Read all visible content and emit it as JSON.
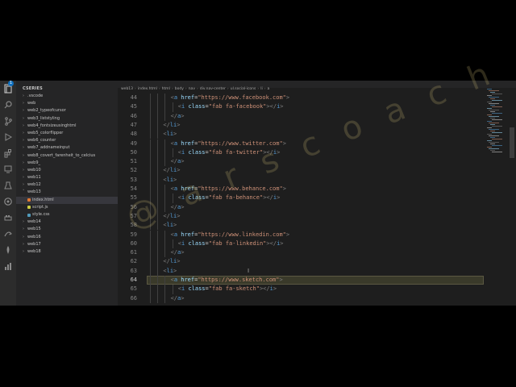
{
  "activity_bar": {
    "badge": "1",
    "icons": [
      "files-icon",
      "search-icon",
      "source-control-icon",
      "run-debug-icon",
      "extensions-icon",
      "remote-explorer-icon",
      "testing-icon",
      "github-icon",
      "docker-icon",
      "live-share-icon",
      "mongodb-icon",
      "chart-icon"
    ]
  },
  "sidebar": {
    "section_title": "CSERIES",
    "items": [
      {
        "label": ".vscode",
        "kind": "folder",
        "depth": 0
      },
      {
        "label": "web",
        "kind": "folder",
        "depth": 0
      },
      {
        "label": "web2_typeofcursor",
        "kind": "folder",
        "depth": 0
      },
      {
        "label": "web3_liststyling",
        "kind": "folder",
        "depth": 0
      },
      {
        "label": "web4_fontsizeusinghtml",
        "kind": "folder",
        "depth": 0
      },
      {
        "label": "web5_colorflipper",
        "kind": "folder",
        "depth": 0
      },
      {
        "label": "web6_counter",
        "kind": "folder",
        "depth": 0
      },
      {
        "label": "web7_addnameinput",
        "kind": "folder",
        "depth": 0
      },
      {
        "label": "web8_covert_farenheit_to_celcius",
        "kind": "folder",
        "depth": 0
      },
      {
        "label": "web9_",
        "kind": "folder",
        "depth": 0
      },
      {
        "label": "web10",
        "kind": "folder",
        "depth": 0
      },
      {
        "label": "web11",
        "kind": "folder",
        "depth": 0
      },
      {
        "label": "web12",
        "kind": "folder",
        "depth": 0
      },
      {
        "label": "web13",
        "kind": "folder-open",
        "depth": 0
      },
      {
        "label": "index.html",
        "kind": "html",
        "depth": 1,
        "active": true
      },
      {
        "label": "script.js",
        "kind": "js",
        "depth": 1
      },
      {
        "label": "style.css",
        "kind": "css",
        "depth": 1
      },
      {
        "label": "web14",
        "kind": "folder",
        "depth": 0
      },
      {
        "label": "web15",
        "kind": "folder",
        "depth": 0
      },
      {
        "label": "web16",
        "kind": "folder",
        "depth": 0
      },
      {
        "label": "web17",
        "kind": "folder",
        "depth": 0
      },
      {
        "label": "web18",
        "kind": "folder",
        "depth": 0
      }
    ]
  },
  "breadcrumbs": [
    "web13",
    "index.html",
    "html",
    "body",
    "nav",
    "div.nav-center",
    "ul.social-icons",
    "li",
    "a"
  ],
  "code_lines": [
    {
      "num": "44",
      "indent": 3,
      "tokens": [
        [
          "bracket",
          "<"
        ],
        [
          "tag",
          "a"
        ],
        [
          "text",
          " "
        ],
        [
          "attr",
          "href"
        ],
        [
          "text",
          "="
        ],
        [
          "val",
          "\"https://www.facebook.com\""
        ],
        [
          "bracket",
          ">"
        ]
      ]
    },
    {
      "num": "45",
      "indent": 4,
      "tokens": [
        [
          "bracket",
          "<"
        ],
        [
          "tag",
          "i"
        ],
        [
          "text",
          " "
        ],
        [
          "attr",
          "class"
        ],
        [
          "text",
          "="
        ],
        [
          "val",
          "\"fab fa-facebook\""
        ],
        [
          "bracket",
          "></"
        ],
        [
          "tag",
          "i"
        ],
        [
          "bracket",
          ">"
        ]
      ]
    },
    {
      "num": "46",
      "indent": 3,
      "tokens": [
        [
          "bracket",
          "</"
        ],
        [
          "tag",
          "a"
        ],
        [
          "bracket",
          ">"
        ]
      ]
    },
    {
      "num": "47",
      "indent": 2,
      "tokens": [
        [
          "bracket",
          "</"
        ],
        [
          "tag",
          "li"
        ],
        [
          "bracket",
          ">"
        ]
      ]
    },
    {
      "num": "48",
      "indent": 2,
      "tokens": [
        [
          "bracket",
          "<"
        ],
        [
          "tag",
          "li"
        ],
        [
          "bracket",
          ">"
        ]
      ]
    },
    {
      "num": "49",
      "indent": 3,
      "tokens": [
        [
          "bracket",
          "<"
        ],
        [
          "tag",
          "a"
        ],
        [
          "text",
          " "
        ],
        [
          "attr",
          "href"
        ],
        [
          "text",
          "="
        ],
        [
          "val",
          "\"https://www.twitter.com\""
        ],
        [
          "bracket",
          ">"
        ]
      ]
    },
    {
      "num": "50",
      "indent": 4,
      "tokens": [
        [
          "bracket",
          "<"
        ],
        [
          "tag",
          "i"
        ],
        [
          "text",
          " "
        ],
        [
          "attr",
          "class"
        ],
        [
          "text",
          "="
        ],
        [
          "val",
          "\"fab fa-twitter\""
        ],
        [
          "bracket",
          "></"
        ],
        [
          "tag",
          "i"
        ],
        [
          "bracket",
          ">"
        ]
      ]
    },
    {
      "num": "51",
      "indent": 3,
      "tokens": [
        [
          "bracket",
          "</"
        ],
        [
          "tag",
          "a"
        ],
        [
          "bracket",
          ">"
        ]
      ]
    },
    {
      "num": "52",
      "indent": 2,
      "tokens": [
        [
          "bracket",
          "</"
        ],
        [
          "tag",
          "li"
        ],
        [
          "bracket",
          ">"
        ]
      ]
    },
    {
      "num": "53",
      "indent": 2,
      "tokens": [
        [
          "bracket",
          "<"
        ],
        [
          "tag",
          "li"
        ],
        [
          "bracket",
          ">"
        ]
      ]
    },
    {
      "num": "54",
      "indent": 3,
      "tokens": [
        [
          "bracket",
          "<"
        ],
        [
          "tag",
          "a"
        ],
        [
          "text",
          " "
        ],
        [
          "attr",
          "href"
        ],
        [
          "text",
          "="
        ],
        [
          "val",
          "\"https://www.behance.com\""
        ],
        [
          "bracket",
          ">"
        ]
      ]
    },
    {
      "num": "55",
      "indent": 4,
      "tokens": [
        [
          "bracket",
          "<"
        ],
        [
          "tag",
          "i"
        ],
        [
          "text",
          " "
        ],
        [
          "attr",
          "class"
        ],
        [
          "text",
          "="
        ],
        [
          "val",
          "\"fab fa-behance\""
        ],
        [
          "bracket",
          "></"
        ],
        [
          "tag",
          "i"
        ],
        [
          "bracket",
          ">"
        ]
      ]
    },
    {
      "num": "56",
      "indent": 3,
      "tokens": [
        [
          "bracket",
          "</"
        ],
        [
          "tag",
          "a"
        ],
        [
          "bracket",
          ">"
        ]
      ]
    },
    {
      "num": "57",
      "indent": 2,
      "tokens": [
        [
          "bracket",
          "</"
        ],
        [
          "tag",
          "li"
        ],
        [
          "bracket",
          ">"
        ]
      ]
    },
    {
      "num": "58",
      "indent": 2,
      "tokens": [
        [
          "bracket",
          "<"
        ],
        [
          "tag",
          "li"
        ],
        [
          "bracket",
          ">"
        ]
      ]
    },
    {
      "num": "59",
      "indent": 3,
      "tokens": [
        [
          "bracket",
          "<"
        ],
        [
          "tag",
          "a"
        ],
        [
          "text",
          " "
        ],
        [
          "attr",
          "href"
        ],
        [
          "text",
          "="
        ],
        [
          "val",
          "\"https://www.linkedin.com\""
        ],
        [
          "bracket",
          ">"
        ]
      ]
    },
    {
      "num": "60",
      "indent": 4,
      "tokens": [
        [
          "bracket",
          "<"
        ],
        [
          "tag",
          "i"
        ],
        [
          "text",
          " "
        ],
        [
          "attr",
          "class"
        ],
        [
          "text",
          "="
        ],
        [
          "val",
          "\"fab fa-linkedin\""
        ],
        [
          "bracket",
          "></"
        ],
        [
          "tag",
          "i"
        ],
        [
          "bracket",
          ">"
        ]
      ]
    },
    {
      "num": "61",
      "indent": 3,
      "tokens": [
        [
          "bracket",
          "</"
        ],
        [
          "tag",
          "a"
        ],
        [
          "bracket",
          ">"
        ]
      ]
    },
    {
      "num": "62",
      "indent": 2,
      "tokens": [
        [
          "bracket",
          "</"
        ],
        [
          "tag",
          "li"
        ],
        [
          "bracket",
          ">"
        ]
      ]
    },
    {
      "num": "63",
      "indent": 2,
      "tokens": [
        [
          "bracket",
          "<"
        ],
        [
          "tag",
          "li"
        ],
        [
          "bracket",
          ">"
        ]
      ]
    },
    {
      "num": "64",
      "indent": 3,
      "current": true,
      "tokens": [
        [
          "bracket",
          "<"
        ],
        [
          "tag",
          "a"
        ],
        [
          "text",
          " "
        ],
        [
          "attr",
          "href"
        ],
        [
          "text",
          "="
        ],
        [
          "val",
          "\"https://www.sketch.com\""
        ],
        [
          "bracket",
          ">"
        ]
      ]
    },
    {
      "num": "65",
      "indent": 4,
      "tokens": [
        [
          "bracket",
          "<"
        ],
        [
          "tag",
          "i"
        ],
        [
          "text",
          " "
        ],
        [
          "attr",
          "class"
        ],
        [
          "text",
          "="
        ],
        [
          "val",
          "\"fab fa-sketch\""
        ],
        [
          "bracket",
          "></"
        ],
        [
          "tag",
          "i"
        ],
        [
          "bracket",
          ">"
        ]
      ]
    },
    {
      "num": "66",
      "indent": 3,
      "tokens": [
        [
          "bracket",
          "</"
        ],
        [
          "tag",
          "a"
        ],
        [
          "bracket",
          ">"
        ]
      ]
    }
  ],
  "watermark": "@ a r s c o a c h",
  "colors": {
    "editor_bg": "#1e1e1e",
    "sidebar_bg": "#252526",
    "activity_bg": "#2c2c2c",
    "tag": "#569cd6",
    "attr": "#9cdcfe",
    "string": "#ce9178",
    "accent": "#0e70c0"
  }
}
